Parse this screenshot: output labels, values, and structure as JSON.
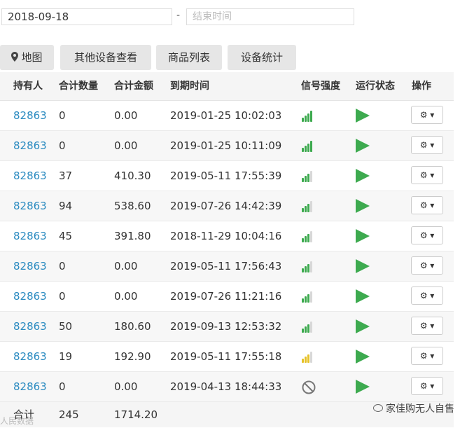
{
  "filters": {
    "start_date": "2018-09-18",
    "separator": "-",
    "end_placeholder": "结束时间"
  },
  "tabs": [
    "地图",
    "其他设备查看",
    "商品列表",
    "设备统计"
  ],
  "columns": [
    "持有人",
    "合计数量",
    "合计金额",
    "到期时间",
    "信号强度",
    "运行状态",
    "操作"
  ],
  "rows": [
    {
      "holder": "82863",
      "qty": "0",
      "amount": "0.00",
      "expiry": "2019-01-25 10:02:03",
      "signal": 4,
      "signal_color": "#3daa4f",
      "status": "running"
    },
    {
      "holder": "82863",
      "qty": "0",
      "amount": "0.00",
      "expiry": "2019-01-25 10:11:09",
      "signal": 4,
      "signal_color": "#3daa4f",
      "status": "running"
    },
    {
      "holder": "82863",
      "qty": "37",
      "amount": "410.30",
      "expiry": "2019-05-11 17:55:39",
      "signal": 3,
      "signal_color": "#3daa4f",
      "status": "running"
    },
    {
      "holder": "82863",
      "qty": "94",
      "amount": "538.60",
      "expiry": "2019-07-26 14:42:39",
      "signal": 3,
      "signal_color": "#3daa4f",
      "status": "running"
    },
    {
      "holder": "82863",
      "qty": "45",
      "amount": "391.80",
      "expiry": "2018-11-29 10:04:16",
      "signal": 3,
      "signal_color": "#3daa4f",
      "status": "running"
    },
    {
      "holder": "82863",
      "qty": "0",
      "amount": "0.00",
      "expiry": "2019-05-11 17:56:43",
      "signal": 3,
      "signal_color": "#3daa4f",
      "status": "running"
    },
    {
      "holder": "82863",
      "qty": "0",
      "amount": "0.00",
      "expiry": "2019-07-26 11:21:16",
      "signal": 3,
      "signal_color": "#3daa4f",
      "status": "running"
    },
    {
      "holder": "82863",
      "qty": "50",
      "amount": "180.60",
      "expiry": "2019-09-13 12:53:32",
      "signal": 3,
      "signal_color": "#3daa4f",
      "status": "running"
    },
    {
      "holder": "82863",
      "qty": "19",
      "amount": "192.90",
      "expiry": "2019-05-11 17:55:18",
      "signal": 3,
      "signal_color": "#e6c229",
      "status": "running"
    },
    {
      "holder": "82863",
      "qty": "0",
      "amount": "0.00",
      "expiry": "2019-04-13 18:44:33",
      "signal": 0,
      "signal_color": "#888888",
      "status": "running"
    }
  ],
  "footer": {
    "label": "合计",
    "qty": "245",
    "amount": "1714.20"
  },
  "watermarks": {
    "right": "家佳购无人自售",
    "left": "人民数据"
  },
  "icons": {
    "map_tab": "map-marker-icon",
    "status": "play-icon",
    "op": "gear-icon",
    "no_signal": "no-signal-icon"
  },
  "colors": {
    "link": "#2a8ac0",
    "running": "#3daa4f",
    "signal_weak": "#e6c229"
  }
}
